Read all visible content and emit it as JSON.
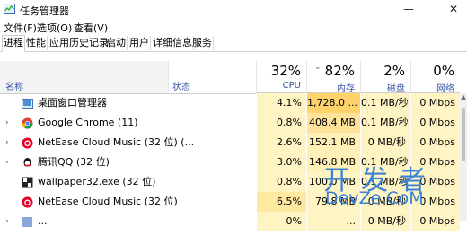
{
  "window": {
    "title": "任务管理器",
    "minimize": "—",
    "close": "✕"
  },
  "menu": [
    "文件(F)",
    "选项(O)",
    "查看(V)"
  ],
  "tabs": [
    "进程",
    "性能",
    "应用历史记录",
    "启动",
    "用户",
    "详细信息",
    "服务"
  ],
  "header": {
    "name": "名称",
    "status": "状态",
    "cpu": {
      "pct": "32%",
      "label": "CPU"
    },
    "mem": {
      "pct": "82%",
      "label": "内存"
    },
    "disk": {
      "pct": "2%",
      "label": "磁盘"
    },
    "net": {
      "pct": "0%",
      "label": "网络"
    }
  },
  "rows": [
    {
      "name": "桌面窗口管理器",
      "expand": "",
      "icon": "dwm-icon",
      "cpu": "4.1%",
      "mem": "1,728.0 ...",
      "disk": "0.1 MB/秒",
      "net": "0 Mbps"
    },
    {
      "name": "Google Chrome (11)",
      "expand": "›",
      "icon": "chrome-icon",
      "cpu": "0.8%",
      "mem": "408.4 MB",
      "disk": "0.1 MB/秒",
      "net": "0 Mbps"
    },
    {
      "name": "NetEase Cloud Music (32 位) (...",
      "expand": "›",
      "icon": "netease-icon",
      "cpu": "2.6%",
      "mem": "152.1 MB",
      "disk": "0 MB/秒",
      "net": "0 Mbps"
    },
    {
      "name": "腾讯QQ (32 位)",
      "expand": "›",
      "icon": "qq-icon",
      "cpu": "3.0%",
      "mem": "146.8 MB",
      "disk": "0.1 MB/秒",
      "net": "0 Mbps"
    },
    {
      "name": "wallpaper32.exe (32 位)",
      "expand": "",
      "icon": "wallpaper-icon",
      "cpu": "0.8%",
      "mem": "100.0 MB",
      "disk": "0.1 MB/秒",
      "net": "0 Mbps"
    },
    {
      "name": "NetEase Cloud Music (32 位)",
      "expand": "",
      "icon": "netease-icon",
      "cpu": "6.5%",
      "mem": "79.8 MB",
      "disk": "0 MB/秒",
      "net": "0 Mbps"
    },
    {
      "name": "...",
      "expand": "›",
      "icon": "generic-icon",
      "cpu": "0%",
      "mem": "...",
      "disk": "0 MB/秒",
      "net": "0 Mbps"
    }
  ],
  "colors": {
    "cpu_light": "#fff4c4",
    "cpu_med": "#ffe8a0",
    "mem_hot": "#ffd26a",
    "mem_med": "#ffe39a",
    "header_blue": "#3a55a4"
  },
  "watermark": {
    "top": "开发者",
    "bottom": "DevZe.CoM"
  }
}
